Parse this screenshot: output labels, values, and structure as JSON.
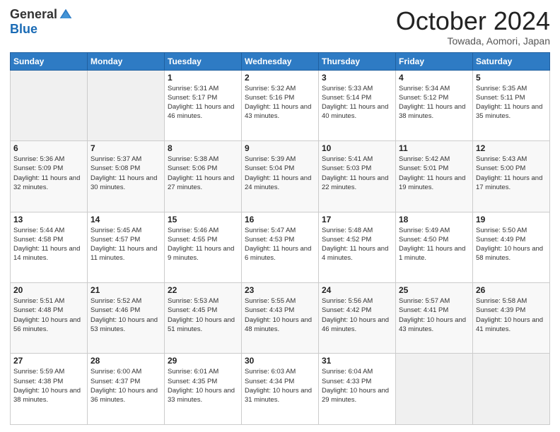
{
  "header": {
    "logo_general": "General",
    "logo_blue": "Blue",
    "month_title": "October 2024",
    "location": "Towada, Aomori, Japan"
  },
  "weekdays": [
    "Sunday",
    "Monday",
    "Tuesday",
    "Wednesday",
    "Thursday",
    "Friday",
    "Saturday"
  ],
  "weeks": [
    [
      {
        "day": "",
        "empty": true
      },
      {
        "day": "",
        "empty": true
      },
      {
        "day": "1",
        "sunrise": "5:31 AM",
        "sunset": "5:17 PM",
        "daylight": "11 hours and 46 minutes."
      },
      {
        "day": "2",
        "sunrise": "5:32 AM",
        "sunset": "5:16 PM",
        "daylight": "11 hours and 43 minutes."
      },
      {
        "day": "3",
        "sunrise": "5:33 AM",
        "sunset": "5:14 PM",
        "daylight": "11 hours and 40 minutes."
      },
      {
        "day": "4",
        "sunrise": "5:34 AM",
        "sunset": "5:12 PM",
        "daylight": "11 hours and 38 minutes."
      },
      {
        "day": "5",
        "sunrise": "5:35 AM",
        "sunset": "5:11 PM",
        "daylight": "11 hours and 35 minutes."
      }
    ],
    [
      {
        "day": "6",
        "sunrise": "5:36 AM",
        "sunset": "5:09 PM",
        "daylight": "11 hours and 32 minutes."
      },
      {
        "day": "7",
        "sunrise": "5:37 AM",
        "sunset": "5:08 PM",
        "daylight": "11 hours and 30 minutes."
      },
      {
        "day": "8",
        "sunrise": "5:38 AM",
        "sunset": "5:06 PM",
        "daylight": "11 hours and 27 minutes."
      },
      {
        "day": "9",
        "sunrise": "5:39 AM",
        "sunset": "5:04 PM",
        "daylight": "11 hours and 24 minutes."
      },
      {
        "day": "10",
        "sunrise": "5:41 AM",
        "sunset": "5:03 PM",
        "daylight": "11 hours and 22 minutes."
      },
      {
        "day": "11",
        "sunrise": "5:42 AM",
        "sunset": "5:01 PM",
        "daylight": "11 hours and 19 minutes."
      },
      {
        "day": "12",
        "sunrise": "5:43 AM",
        "sunset": "5:00 PM",
        "daylight": "11 hours and 17 minutes."
      }
    ],
    [
      {
        "day": "13",
        "sunrise": "5:44 AM",
        "sunset": "4:58 PM",
        "daylight": "11 hours and 14 minutes."
      },
      {
        "day": "14",
        "sunrise": "5:45 AM",
        "sunset": "4:57 PM",
        "daylight": "11 hours and 11 minutes."
      },
      {
        "day": "15",
        "sunrise": "5:46 AM",
        "sunset": "4:55 PM",
        "daylight": "11 hours and 9 minutes."
      },
      {
        "day": "16",
        "sunrise": "5:47 AM",
        "sunset": "4:53 PM",
        "daylight": "11 hours and 6 minutes."
      },
      {
        "day": "17",
        "sunrise": "5:48 AM",
        "sunset": "4:52 PM",
        "daylight": "11 hours and 4 minutes."
      },
      {
        "day": "18",
        "sunrise": "5:49 AM",
        "sunset": "4:50 PM",
        "daylight": "11 hours and 1 minute."
      },
      {
        "day": "19",
        "sunrise": "5:50 AM",
        "sunset": "4:49 PM",
        "daylight": "10 hours and 58 minutes."
      }
    ],
    [
      {
        "day": "20",
        "sunrise": "5:51 AM",
        "sunset": "4:48 PM",
        "daylight": "10 hours and 56 minutes."
      },
      {
        "day": "21",
        "sunrise": "5:52 AM",
        "sunset": "4:46 PM",
        "daylight": "10 hours and 53 minutes."
      },
      {
        "day": "22",
        "sunrise": "5:53 AM",
        "sunset": "4:45 PM",
        "daylight": "10 hours and 51 minutes."
      },
      {
        "day": "23",
        "sunrise": "5:55 AM",
        "sunset": "4:43 PM",
        "daylight": "10 hours and 48 minutes."
      },
      {
        "day": "24",
        "sunrise": "5:56 AM",
        "sunset": "4:42 PM",
        "daylight": "10 hours and 46 minutes."
      },
      {
        "day": "25",
        "sunrise": "5:57 AM",
        "sunset": "4:41 PM",
        "daylight": "10 hours and 43 minutes."
      },
      {
        "day": "26",
        "sunrise": "5:58 AM",
        "sunset": "4:39 PM",
        "daylight": "10 hours and 41 minutes."
      }
    ],
    [
      {
        "day": "27",
        "sunrise": "5:59 AM",
        "sunset": "4:38 PM",
        "daylight": "10 hours and 38 minutes."
      },
      {
        "day": "28",
        "sunrise": "6:00 AM",
        "sunset": "4:37 PM",
        "daylight": "10 hours and 36 minutes."
      },
      {
        "day": "29",
        "sunrise": "6:01 AM",
        "sunset": "4:35 PM",
        "daylight": "10 hours and 33 minutes."
      },
      {
        "day": "30",
        "sunrise": "6:03 AM",
        "sunset": "4:34 PM",
        "daylight": "10 hours and 31 minutes."
      },
      {
        "day": "31",
        "sunrise": "6:04 AM",
        "sunset": "4:33 PM",
        "daylight": "10 hours and 29 minutes."
      },
      {
        "day": "",
        "empty": true
      },
      {
        "day": "",
        "empty": true
      }
    ]
  ]
}
